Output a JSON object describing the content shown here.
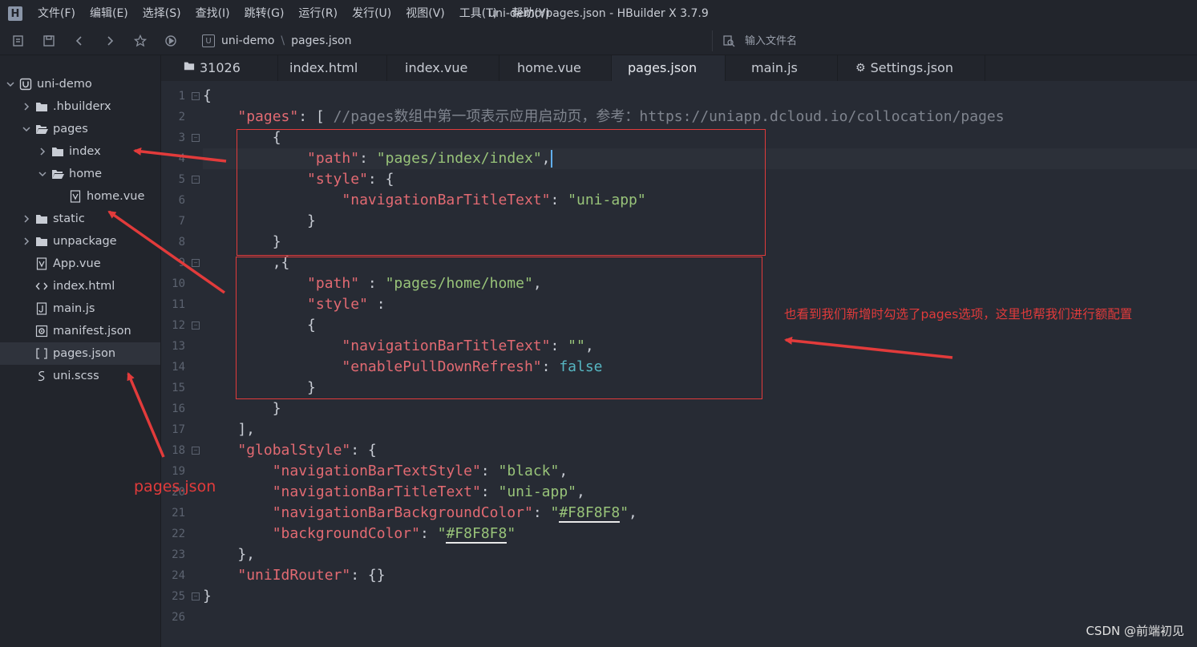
{
  "window": {
    "logo": "H",
    "title": "uni-demo/pages.json - HBuilder X 3.7.9"
  },
  "menu": [
    {
      "label": "文件(F)"
    },
    {
      "label": "编辑(E)"
    },
    {
      "label": "选择(S)"
    },
    {
      "label": "查找(I)"
    },
    {
      "label": "跳转(G)"
    },
    {
      "label": "运行(R)"
    },
    {
      "label": "发行(U)"
    },
    {
      "label": "视图(V)"
    },
    {
      "label": "工具(T)"
    },
    {
      "label": "帮助(Y)"
    }
  ],
  "toolbar": {
    "breadcrumb": [
      "uni-demo",
      "pages.json"
    ],
    "breadcrumb_separator": "\\",
    "file_search_placeholder": "输入文件名"
  },
  "sidebar": {
    "tree": [
      {
        "label": "uni-demo",
        "icon": "project-icon"
      },
      {
        "label": ".hbuilderx",
        "icon": "folder-icon"
      },
      {
        "label": "pages",
        "icon": "folder-open-icon"
      },
      {
        "label": "index",
        "icon": "folder-icon"
      },
      {
        "label": "home",
        "icon": "folder-open-icon"
      },
      {
        "label": "home.vue",
        "icon": "vue-file-icon"
      },
      {
        "label": "static",
        "icon": "folder-icon"
      },
      {
        "label": "unpackage",
        "icon": "folder-icon"
      },
      {
        "label": "App.vue",
        "icon": "vue-file-icon"
      },
      {
        "label": "index.html",
        "icon": "html-file-icon"
      },
      {
        "label": "main.js",
        "icon": "js-file-icon"
      },
      {
        "label": "manifest.json",
        "icon": "manifest-file-icon"
      },
      {
        "label": "pages.json",
        "icon": "json-file-icon",
        "selected": true
      },
      {
        "label": "uni.scss",
        "icon": "scss-file-icon"
      }
    ]
  },
  "tabs": [
    {
      "label": "31026",
      "icon": "folder-icon"
    },
    {
      "label": "index.html"
    },
    {
      "label": "index.vue"
    },
    {
      "label": "home.vue"
    },
    {
      "label": "pages.json",
      "active": true
    },
    {
      "label": "main.js"
    },
    {
      "label": "Settings.json",
      "icon": "gear-icon"
    }
  ],
  "editor": {
    "current_line": 4,
    "lines": [
      "1",
      "2",
      "3",
      "4",
      "5",
      "6",
      "7",
      "8",
      "9",
      "10",
      "11",
      "12",
      "13",
      "14",
      "15",
      "16",
      "17",
      "18",
      "19",
      "20",
      "21",
      "22",
      "23",
      "24",
      "25",
      "26"
    ],
    "foldable_lines": [
      1,
      3,
      5,
      9,
      12,
      18,
      25
    ],
    "code": {
      "l1": "{",
      "l2_key": "\"pages\"",
      "l2_rest": ": [ ",
      "l2_comment": "//pages数组中第一项表示应用启动页，参考：https://uniapp.dcloud.io/collocation/pages",
      "l3": "        {",
      "l4_key": "\"path\"",
      "l4_val": "\"pages/index/index\"",
      "l5_key": "\"style\"",
      "l5_rest": ": {",
      "l6_key": "\"navigationBarTitleText\"",
      "l6_val": "\"uni-app\"",
      "l7": "            }",
      "l8": "        }",
      "l9": "        ,{",
      "l10_key": "\"path\"",
      "l10_val": "\"pages/home/home\"",
      "l11_key": "\"style\"",
      "l11_rest": " :",
      "l12": "            {",
      "l13_key": "\"navigationBarTitleText\"",
      "l13_val": "\"\"",
      "l14_key": "\"enablePullDownRefresh\"",
      "l14_val": "false",
      "l15": "            }",
      "l16": "        }",
      "l17": "    ],",
      "l18_key": "\"globalStyle\"",
      "l18_rest": ": {",
      "l19_key": "\"navigationBarTextStyle\"",
      "l19_val": "\"black\"",
      "l20_key": "\"navigationBarTitleText\"",
      "l20_val": "\"uni-app\"",
      "l21_key": "\"navigationBarBackgroundColor\"",
      "l21_val_q": "\"",
      "l21_val": "#F8F8F8",
      "l22_key": "\"backgroundColor\"",
      "l22_val_q": "\"",
      "l22_val": "#F8F8F8",
      "l23": "    },",
      "l24_key": "\"uniIdRouter\"",
      "l24_rest": ": {}",
      "l25": "}",
      "l26": ""
    }
  },
  "annotations": {
    "pages_json_label": "pages.json",
    "config_note": "也看到我们新增时勾选了pages选项，这里也帮我们进行额配置",
    "color": "#e23b3b"
  },
  "watermark": "CSDN @前端初见"
}
